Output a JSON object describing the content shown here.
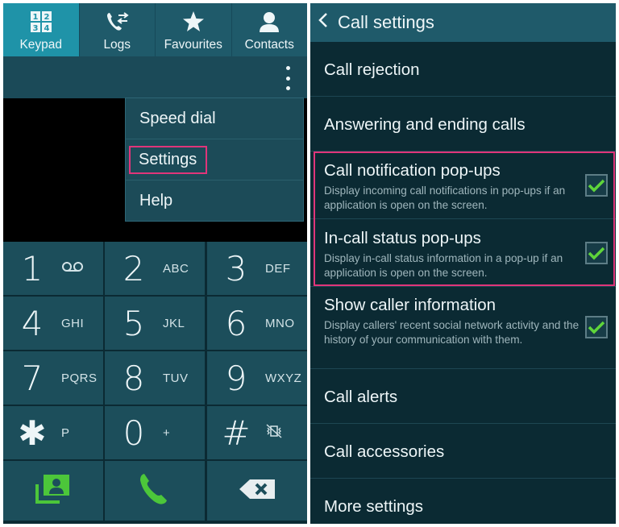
{
  "dialer": {
    "tabs": [
      {
        "label": "Keypad",
        "icon": "keypad-icon",
        "active": true
      },
      {
        "label": "Logs",
        "icon": "logs-icon",
        "active": false
      },
      {
        "label": "Favourites",
        "icon": "star-icon",
        "active": false
      },
      {
        "label": "Contacts",
        "icon": "contact-icon",
        "active": false
      }
    ],
    "keypad_icon_digits": [
      "1",
      "2",
      "3",
      "4"
    ],
    "menu": [
      "Speed dial",
      "Settings",
      "Help"
    ],
    "highlighted_menu_item": "Settings",
    "keys": [
      {
        "num": "1",
        "letters": ""
      },
      {
        "num": "2",
        "letters": "ABC"
      },
      {
        "num": "3",
        "letters": "DEF"
      },
      {
        "num": "4",
        "letters": "GHI"
      },
      {
        "num": "5",
        "letters": "JKL"
      },
      {
        "num": "6",
        "letters": "MNO"
      },
      {
        "num": "7",
        "letters": "PQRS"
      },
      {
        "num": "8",
        "letters": "TUV"
      },
      {
        "num": "9",
        "letters": "WXYZ"
      },
      {
        "num": "✱",
        "letters": "P"
      },
      {
        "num": "0",
        "letters": "+"
      },
      {
        "num": "#",
        "letters": ""
      }
    ],
    "colors": {
      "accent": "#1f93a8",
      "call_green": "#4cc63a",
      "highlight": "#e0357a"
    }
  },
  "settings": {
    "title": "Call settings",
    "items": [
      {
        "title": "Call rejection"
      },
      {
        "title": "Answering and ending calls"
      },
      {
        "title": "Call notification pop-ups",
        "desc": "Display incoming call notifications in pop-ups if an application is open on the screen.",
        "checked": true
      },
      {
        "title": "In-call status pop-ups",
        "desc": "Display in-call status information in a pop-up if an application is open on the screen.",
        "checked": true
      },
      {
        "title": "Show caller information",
        "desc": "Display callers' recent social network activity and the history of your communication with them.",
        "checked": true
      },
      {
        "title": "Call alerts"
      },
      {
        "title": "Call accessories"
      },
      {
        "title": "More settings"
      }
    ]
  }
}
